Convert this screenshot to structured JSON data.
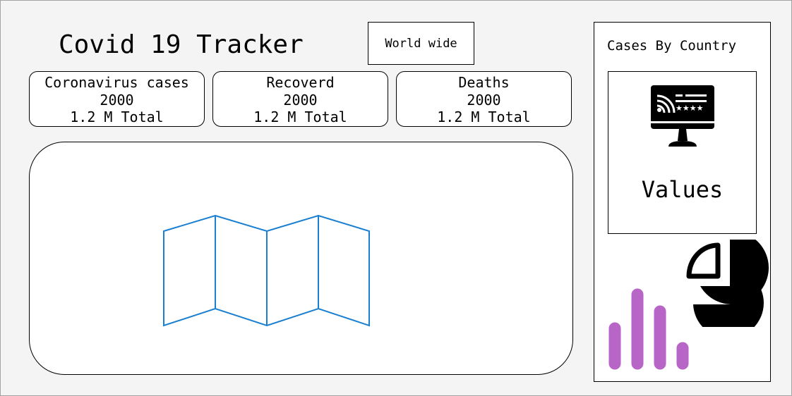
{
  "header": {
    "title": "Covid 19 Tracker",
    "scope_button": "World wide"
  },
  "stats": [
    {
      "label": "Coronavirus cases",
      "value": "2000",
      "total": "1.2 M Total"
    },
    {
      "label": "Recoverd",
      "value": "2000",
      "total": "1.2 M Total"
    },
    {
      "label": "Deaths",
      "value": "2000",
      "total": "1.2 M Total"
    }
  ],
  "map": {
    "icon": "folded-map-icon",
    "color": "#1a7fd0"
  },
  "sidebar": {
    "title": "Cases By Country",
    "values_label": "Values",
    "monitor_icon": "monitor-dashboard-icon",
    "bar_chart_icon": "bar-chart-icon",
    "pie_chart_icon": "pie-chart-icon",
    "bar_color": "#b865c8"
  }
}
